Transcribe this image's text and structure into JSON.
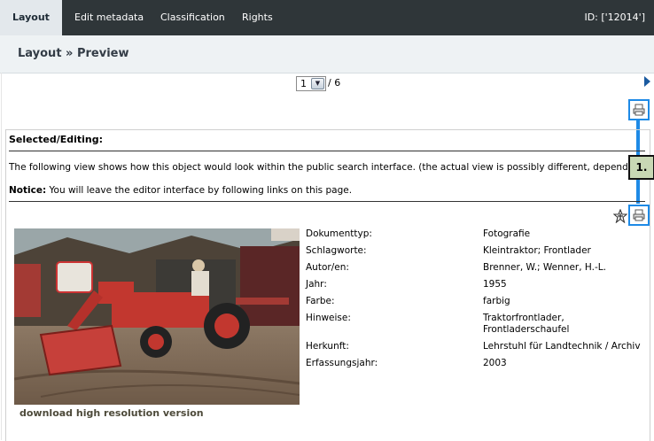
{
  "tabs": [
    {
      "label": "Layout",
      "active": true
    },
    {
      "label": "Edit metadata"
    },
    {
      "label": "Classification"
    },
    {
      "label": "Rights"
    }
  ],
  "object_id": "ID: ['12014']",
  "page_title": "Layout » Preview",
  "pager": {
    "current": "1",
    "total": "/ 6"
  },
  "selected_title": "Selected/Editing:",
  "description": "The following view shows how this object would look within the public search interface. (the actual view is possibly different, depending on selected skin or layout)",
  "notice_label": "Notice:",
  "notice_text": " You will leave the editor interface by following links on this page.",
  "callout_label": "1.",
  "download_label": "download high resolution version",
  "metadata": [
    {
      "key": "Dokumenttyp:",
      "value": "Fotografie"
    },
    {
      "key": "Schlagworte:",
      "value": "Kleintraktor; Frontlader"
    },
    {
      "key": "Autor/en:",
      "value": "Brenner, W.; Wenner, H.-L."
    },
    {
      "key": "Jahr:",
      "value": "1955"
    },
    {
      "key": "Farbe:",
      "value": "farbig"
    },
    {
      "key": "Hinweise:",
      "value": "Traktorfrontlader, Frontladerschaufel"
    },
    {
      "key": "Herkunft:",
      "value": "Lehrstuhl für Landtechnik / Archiv"
    },
    {
      "key": "Erfassungsjahr:",
      "value": "2003"
    }
  ],
  "colors": {
    "topbar": "#2f3639",
    "active_tab": "#e3e8ec",
    "highlight": "#1e8ae6",
    "callout": "#c8d8b4"
  }
}
